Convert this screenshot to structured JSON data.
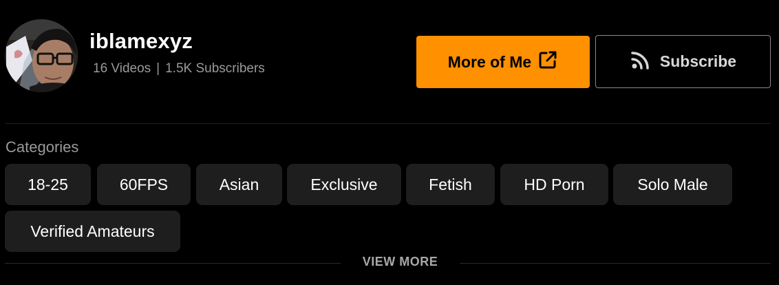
{
  "profile": {
    "username": "iblamexyz",
    "videos": "16 Videos",
    "separator": "|",
    "subscribers": "1.5K Subscribers",
    "avatar_icon": "user-avatar-photo"
  },
  "actions": {
    "more_label": "More of Me",
    "more_icon": "external-link-icon",
    "subscribe_label": "Subscribe",
    "subscribe_icon": "rss-icon",
    "accent_color": "#ff9000"
  },
  "categories": {
    "heading": "Categories",
    "items": [
      {
        "label": "18-25"
      },
      {
        "label": "60FPS"
      },
      {
        "label": "Asian"
      },
      {
        "label": "Exclusive"
      },
      {
        "label": "Fetish"
      },
      {
        "label": "HD Porn"
      },
      {
        "label": "Solo Male"
      },
      {
        "label": "Verified Amateurs"
      }
    ],
    "view_more": "VIEW MORE"
  }
}
